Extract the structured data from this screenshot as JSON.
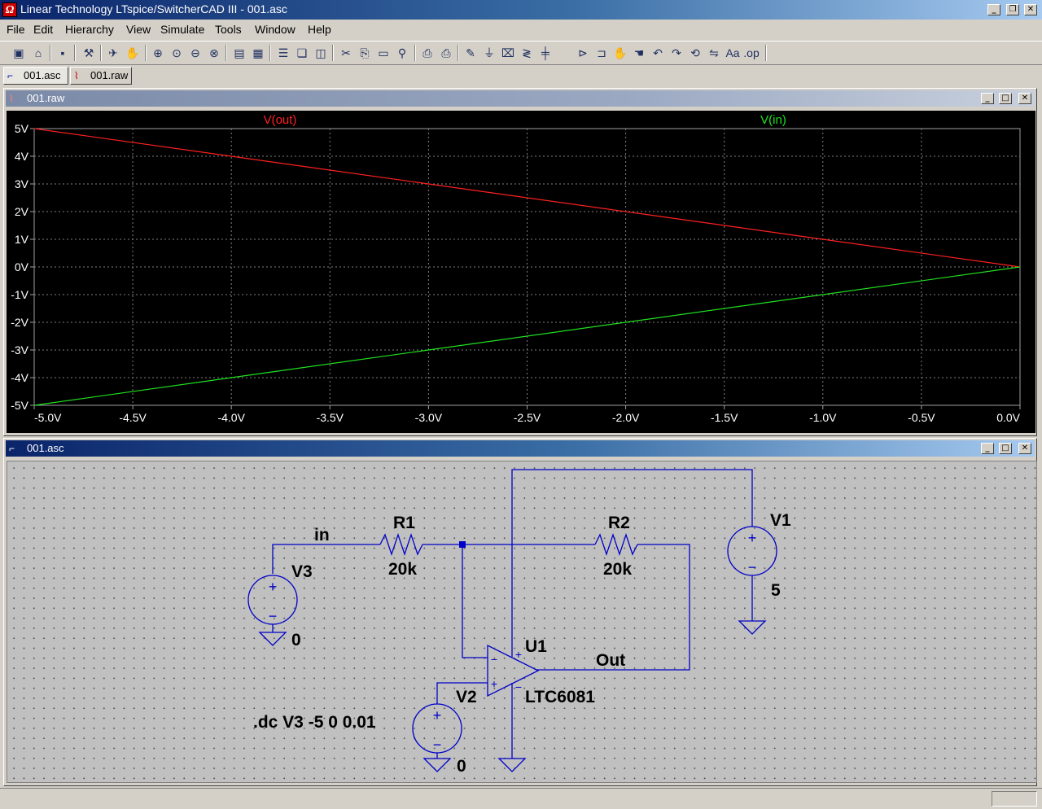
{
  "window": {
    "title": "Linear Technology LTspice/SwitcherCAD III - 001.asc",
    "icon": "ltspice-logo-icon",
    "minimize": "_",
    "restore": "❐",
    "close": "✕"
  },
  "menu": [
    "File",
    "Edit",
    "Hierarchy",
    "View",
    "Simulate",
    "Tools",
    "Window",
    "Help"
  ],
  "toolbar": [
    "new-schematic-icon",
    "open-icon",
    "save-icon",
    "control-panel-icon",
    "run-icon",
    "halt-icon",
    "zoom-in-icon",
    "zoom-pan-icon",
    "zoom-out-icon",
    "zoom-fit-icon",
    "autorange-icon",
    "grid-icon",
    "tile-horizontal-icon",
    "cascade-icon",
    "tile-vertical-icon",
    "cut-icon",
    "copy-icon",
    "paste-icon",
    "find-icon",
    "print-setup-icon",
    "print-icon",
    "wire-icon",
    "ground-icon",
    "label-icon",
    "resistor-icon",
    "capacitor-icon",
    "diode-icon",
    "component-icon",
    "move-icon",
    "drag-icon",
    "undo-icon",
    "redo-icon",
    "rotate-icon",
    "mirror-icon",
    "text-icon",
    "spice-directive-icon"
  ],
  "tabs": [
    {
      "label": "001.asc",
      "icon": "schematic-icon",
      "active": true
    },
    {
      "label": "001.raw",
      "icon": "waveform-icon",
      "active": false
    }
  ],
  "plot_window": {
    "title": "001.raw",
    "icon": "waveform-icon"
  },
  "schematic_window": {
    "title": "001.asc",
    "icon": "schematic-icon"
  },
  "chart_data": {
    "type": "line",
    "title": "",
    "xlabel": "",
    "ylabel": "",
    "xlim": [
      -5.0,
      0.0
    ],
    "ylim": [
      -5,
      5
    ],
    "x_ticks": [
      "-5.0V",
      "-4.5V",
      "-4.0V",
      "-3.5V",
      "-3.0V",
      "-2.5V",
      "-2.0V",
      "-1.5V",
      "-1.0V",
      "-0.5V",
      "0.0V"
    ],
    "y_ticks": [
      "5V",
      "4V",
      "3V",
      "2V",
      "1V",
      "0V",
      "-1V",
      "-2V",
      "-3V",
      "-4V",
      "-5V"
    ],
    "grid": true,
    "background": "#000000",
    "series": [
      {
        "name": "V(out)",
        "color": "#ff2020",
        "x": [
          -5.0,
          -4.0,
          -3.0,
          -2.0,
          -1.0,
          0.0
        ],
        "y": [
          5,
          4,
          3,
          2,
          1,
          0
        ]
      },
      {
        "name": "V(in)",
        "color": "#20e020",
        "x": [
          -5.0,
          -4.0,
          -3.0,
          -2.0,
          -1.0,
          0.0
        ],
        "y": [
          -5,
          -4,
          -3,
          -2,
          -1,
          0
        ]
      }
    ]
  },
  "schematic": {
    "wire_color": "#0000c8",
    "labels": {
      "in": "in",
      "r1_name": "R1",
      "r1_value": "20k",
      "r2_name": "R2",
      "r2_value": "20k",
      "v1_name": "V1",
      "v1_value": "5",
      "v2_name": "V2",
      "v2_value": "0",
      "v3_name": "V3",
      "v3_value": "0",
      "u1_name": "U1",
      "u1_value": "LTC6081",
      "out": "Out",
      "directive": ".dc V3 -5 0 0.01",
      "plus": "+",
      "minus": "−"
    }
  }
}
